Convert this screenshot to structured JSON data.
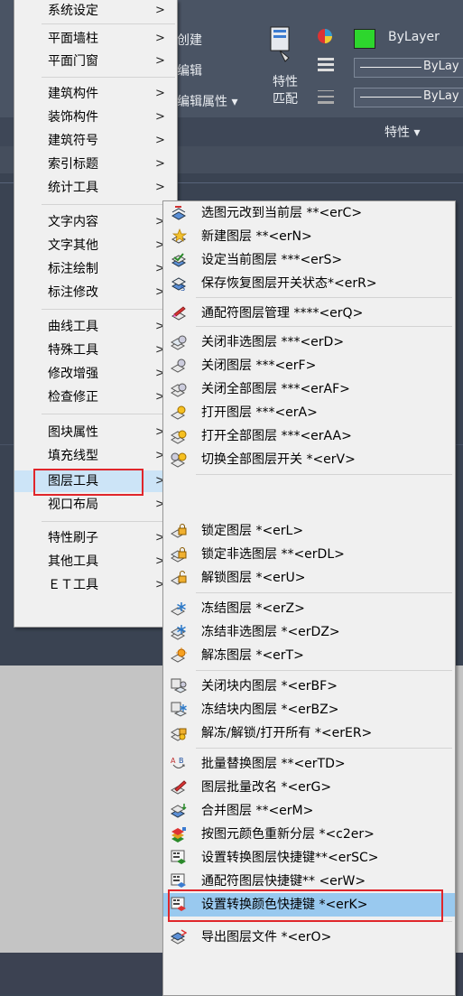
{
  "ribbon": {
    "items": [
      "创建",
      "编辑",
      "编辑属性 ▾",
      "特性",
      "匹配",
      "特性 ▾"
    ],
    "bylayer_color": "ByLayer",
    "bylayer_linetype": "ByLay",
    "bylayer_lineweight": "ByLay",
    "color_swatch": "#22cc22"
  },
  "main_menu": {
    "items": [
      {
        "label": "系统设定",
        "icon": "chevron-right"
      },
      {
        "label": "平面墙柱"
      },
      {
        "label": "平面门窗"
      },
      {
        "label": "建筑构件"
      },
      {
        "label": "装饰构件"
      },
      {
        "label": "建筑符号"
      },
      {
        "label": "索引标题"
      },
      {
        "label": "统计工具"
      },
      {
        "label": "文字内容"
      },
      {
        "label": "文字其他"
      },
      {
        "label": "标注绘制"
      },
      {
        "label": "标注修改"
      },
      {
        "label": "曲线工具"
      },
      {
        "label": "特殊工具"
      },
      {
        "label": "修改增强"
      },
      {
        "label": "检查修正"
      },
      {
        "label": "图块属性"
      },
      {
        "label": "填充线型"
      },
      {
        "label": "图层工具",
        "selected": true
      },
      {
        "label": "视口布局"
      },
      {
        "label": "特性刷子"
      },
      {
        "label": "其他工具"
      },
      {
        "label": "ＥＴ工具"
      }
    ],
    "arrow": ">"
  },
  "sub_menu": {
    "items": [
      {
        "label": "选图元改到当前层 **<erC>",
        "icon": "layer-move-icon"
      },
      {
        "label": "新建图层        **<erN>",
        "icon": "new-layer-icon"
      },
      {
        "label": "设定当前图层    ***<erS>",
        "icon": "set-current-layer-icon"
      },
      {
        "label": "保存恢复图层开关状态*<erR>",
        "icon": "save-layer-state-icon"
      },
      {
        "label": "通配符图层管理 ****<erQ>",
        "icon": "wildcard-layer-icon"
      },
      {
        "label": "关闭非选图层    ***<erD>",
        "icon": "layer-off-others-icon"
      },
      {
        "label": "关闭图层       ***<erF>",
        "icon": "layer-off-icon"
      },
      {
        "label": "关闭全部图层   ***<erAF>",
        "icon": "layer-off-all-icon"
      },
      {
        "label": "打开图层       ***<erA>",
        "icon": "layer-on-icon"
      },
      {
        "label": "打开全部图层   ***<erAA>",
        "icon": "layer-on-all-icon"
      },
      {
        "label": "切换全部图层开关  *<erV>",
        "icon": "layer-toggle-icon"
      },
      {
        "label": "锁定图层        *<erL>",
        "icon": "layer-lock-icon"
      },
      {
        "label": "锁定非选图层    **<erDL>",
        "icon": "layer-lock-others-icon"
      },
      {
        "label": "解锁图层        *<erU>",
        "icon": "layer-unlock-icon"
      },
      {
        "label": "冻结图层        *<erZ>",
        "icon": "layer-freeze-icon"
      },
      {
        "label": "冻结非选图层     *<erDZ>",
        "icon": "layer-freeze-others-icon"
      },
      {
        "label": "解冻图层        *<erT>",
        "icon": "layer-thaw-icon"
      },
      {
        "label": "关闭块内图层     *<erBF>",
        "icon": "block-layer-off-icon"
      },
      {
        "label": "冻结块内图层     *<erBZ>",
        "icon": "block-layer-freeze-icon"
      },
      {
        "label": "解冻/解锁/打开所有 *<erER>",
        "icon": "layer-reset-all-icon"
      },
      {
        "label": "批量替换图层    **<erTD>",
        "icon": "batch-replace-layer-icon"
      },
      {
        "label": "图层批量改名     *<erG>",
        "icon": "batch-rename-layer-icon"
      },
      {
        "label": "合并图层       **<erM>",
        "icon": "merge-layer-icon"
      },
      {
        "label": "按图元颜色重新分层 *<c2er>",
        "icon": "relayer-by-color-icon"
      },
      {
        "label": "设置转换图层快捷键**<erSC>",
        "icon": "layer-shortcut-icon"
      },
      {
        "label": "通配符图层快捷键**  <erW>",
        "icon": "wildcard-shortcut-icon"
      },
      {
        "label": "设置转换颜色快捷键 *<erK>",
        "icon": "color-shortcut-icon",
        "highlighted": true
      },
      {
        "label": "导出图层文件      *<erO>",
        "icon": "export-layer-icon"
      }
    ]
  }
}
